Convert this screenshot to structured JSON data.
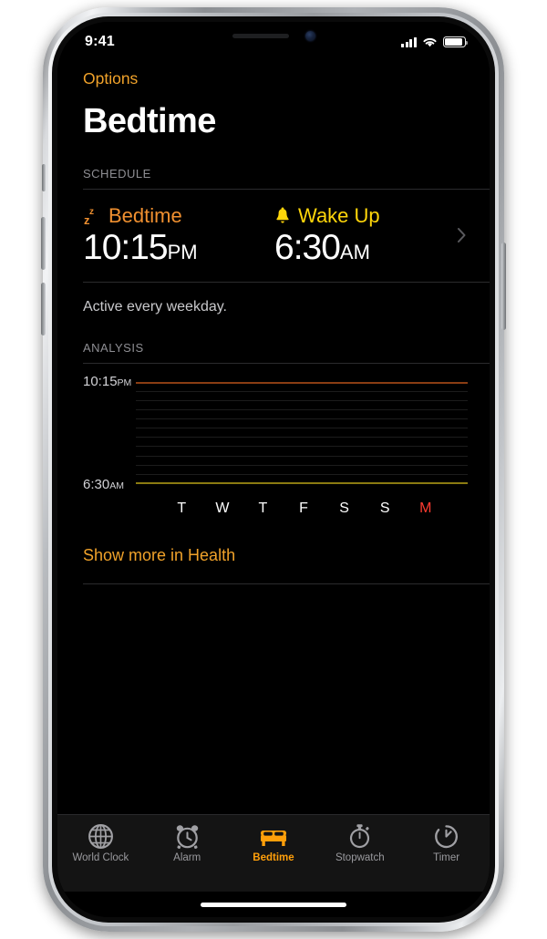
{
  "status_bar": {
    "time": "9:41",
    "signal_icon": "cellular-signal-icon",
    "wifi_icon": "wifi-icon",
    "battery_icon": "battery-icon"
  },
  "nav": {
    "options_label": "Options",
    "title": "Bedtime"
  },
  "schedule": {
    "section_header": "SCHEDULE",
    "bedtime": {
      "icon": "zzz-icon",
      "label": "Bedtime",
      "time": "10:15",
      "meridiem": "PM",
      "color": "#f09030"
    },
    "wakeup": {
      "icon": "bell-icon",
      "label": "Wake Up",
      "time": "6:30",
      "meridiem": "AM",
      "color": "#ffd60a"
    },
    "chevron_icon": "chevron-right-icon",
    "active_note": "Active every weekday."
  },
  "analysis": {
    "section_header": "ANALYSIS",
    "health_link": "Show more in Health"
  },
  "chart_data": {
    "type": "bar",
    "title": "ANALYSIS",
    "categories": [
      "T",
      "W",
      "T",
      "F",
      "S",
      "S",
      "M"
    ],
    "today_index": 6,
    "y_axis_top_label": "10:15",
    "y_axis_top_meridiem": "PM",
    "y_axis_bottom_label": "6:30",
    "y_axis_bottom_meridiem": "AM",
    "ylim": [
      "10:15PM",
      "6:30AM"
    ],
    "values": [
      0,
      0,
      0,
      0,
      0,
      0,
      0
    ],
    "gridline_count": 12,
    "bedtime_line_color": "#8a3d13",
    "wakeup_line_color": "#8b7b11",
    "gridline_color": "rgba(255,255,255,0.11)",
    "xlabel": "",
    "ylabel": "",
    "legend": [],
    "grid": true,
    "note": "No sleep data bars recorded for the displayed week; only bedtime and wake-up reference lines are drawn."
  },
  "tabbar": {
    "active_index": 2,
    "tabs": [
      {
        "label": "World Clock",
        "icon": "globe-icon"
      },
      {
        "label": "Alarm",
        "icon": "alarm-clock-icon"
      },
      {
        "label": "Bedtime",
        "icon": "bed-icon"
      },
      {
        "label": "Stopwatch",
        "icon": "stopwatch-icon"
      },
      {
        "label": "Timer",
        "icon": "timer-icon"
      }
    ]
  },
  "colors": {
    "accent_orange": "#f0a22a",
    "tab_active": "#ff9f0a",
    "today_red": "#ff3b30",
    "yellow": "#ffd60a",
    "background": "#000000"
  }
}
